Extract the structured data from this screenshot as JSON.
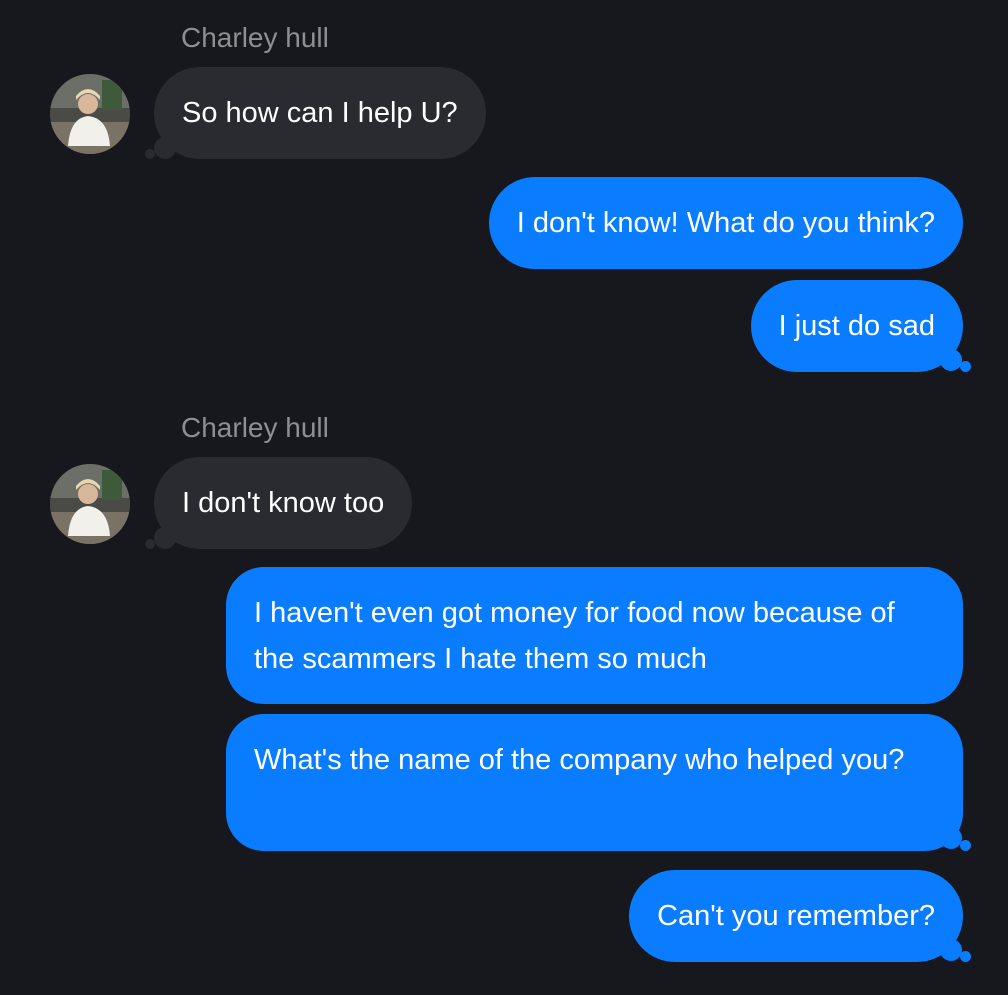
{
  "colors": {
    "background": "#17181d",
    "incoming_bubble": "#2a2b30",
    "outgoing_bubble": "#0a7cff",
    "sender_name": "#8e8e93",
    "text": "#ffffff"
  },
  "messages": [
    {
      "direction": "incoming",
      "sender": "Charley hull",
      "avatar_icon": "profile-photo-icon",
      "text": "So how can I help U?"
    },
    {
      "direction": "outgoing",
      "text": "I don't know! What do you think?"
    },
    {
      "direction": "outgoing",
      "text": "I just do sad"
    },
    {
      "direction": "incoming",
      "sender": "Charley hull",
      "avatar_icon": "profile-photo-icon",
      "text": "I don't know too"
    },
    {
      "direction": "outgoing",
      "text": "I haven't even got money for food now because of the scammers I hate them so much"
    },
    {
      "direction": "outgoing",
      "text": "What's the name of the company who helped you?"
    },
    {
      "direction": "outgoing",
      "text": "Can't you remember?"
    }
  ]
}
